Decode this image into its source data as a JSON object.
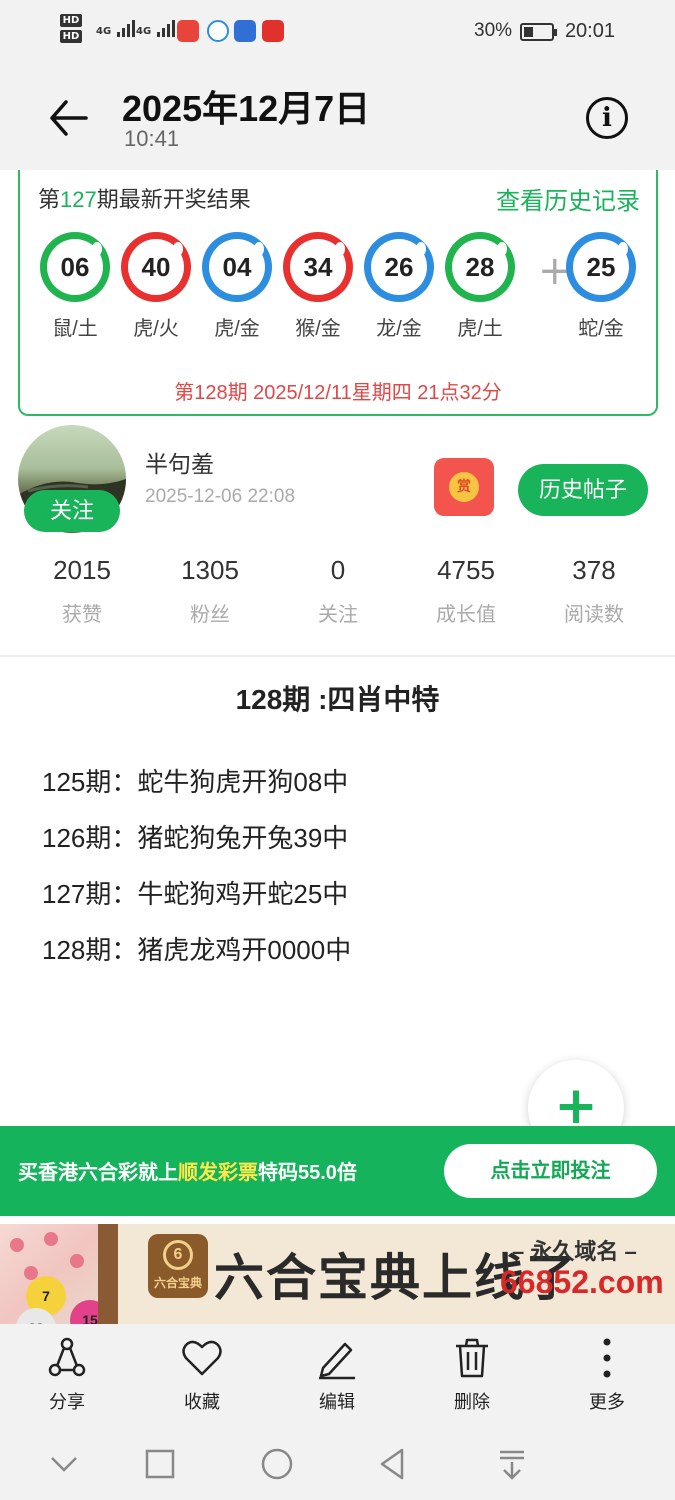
{
  "status_bar": {
    "battery_percent": "30%",
    "time": "20:01",
    "hd1": "HD",
    "hd2": "HD",
    "net1": "4G",
    "net2": "4G"
  },
  "header": {
    "title": "2025年12月7日",
    "subtitle": "10:41"
  },
  "lottery": {
    "title_prefix": "第",
    "issue": "127",
    "title_suffix": "期最新开奖结果",
    "history_link": "查看历史记录",
    "balls": [
      {
        "number": "06",
        "label": "鼠/土",
        "color": "#1fb44e"
      },
      {
        "number": "40",
        "label": "虎/火",
        "color": "#e8312f"
      },
      {
        "number": "04",
        "label": "虎/金",
        "color": "#2d8ee0"
      },
      {
        "number": "34",
        "label": "猴/金",
        "color": "#e8312f"
      },
      {
        "number": "26",
        "label": "龙/金",
        "color": "#2d8ee0"
      },
      {
        "number": "28",
        "label": "虎/土",
        "color": "#1fb44e"
      }
    ],
    "plus": "+",
    "special_ball": {
      "number": "25",
      "label": "蛇/金",
      "color": "#2d8ee0"
    },
    "next_draw": "第128期 2025/12/11星期四  21点32分"
  },
  "author": {
    "name": "半句羞",
    "time": "2025-12-06 22:08",
    "follow_label": "关注",
    "reward_label": "赏",
    "history_button": "历史帖子"
  },
  "stats": [
    {
      "value": "2015",
      "label": "获赞"
    },
    {
      "value": "1305",
      "label": "粉丝"
    },
    {
      "value": "0",
      "label": "关注"
    },
    {
      "value": "4755",
      "label": "成长值"
    },
    {
      "value": "378",
      "label": "阅读数"
    }
  ],
  "post": {
    "title": "128期 :四肖中特",
    "lines": [
      "125期：蛇牛狗虎开狗08中",
      "126期：猪蛇狗兔开兔39中",
      "127期：牛蛇狗鸡开蛇25中",
      "128期：猪虎龙鸡开0000中"
    ]
  },
  "fab": {
    "label": "+"
  },
  "promo": {
    "text_before": "买香港六合彩就上",
    "highlight": "顺发彩票",
    "text_after": "特码55.0倍",
    "button": "点击立即投注"
  },
  "ad": {
    "logo_text": "六合宝典",
    "logo_num": "6",
    "headline": "六合宝典上线了",
    "subline": "– 永久域名 –",
    "domain": "66852.com",
    "balls": [
      "7",
      "28",
      "15"
    ]
  },
  "toolbar": {
    "items": [
      {
        "label": "分享",
        "icon": "share-icon"
      },
      {
        "label": "收藏",
        "icon": "heart-icon"
      },
      {
        "label": "编辑",
        "icon": "pen-icon"
      },
      {
        "label": "删除",
        "icon": "trash-icon"
      },
      {
        "label": "更多",
        "icon": "more-icon"
      }
    ]
  },
  "colors": {
    "accent": "#19b35a",
    "promo_bg": "#14b35c",
    "next_draw": "#e04848"
  }
}
